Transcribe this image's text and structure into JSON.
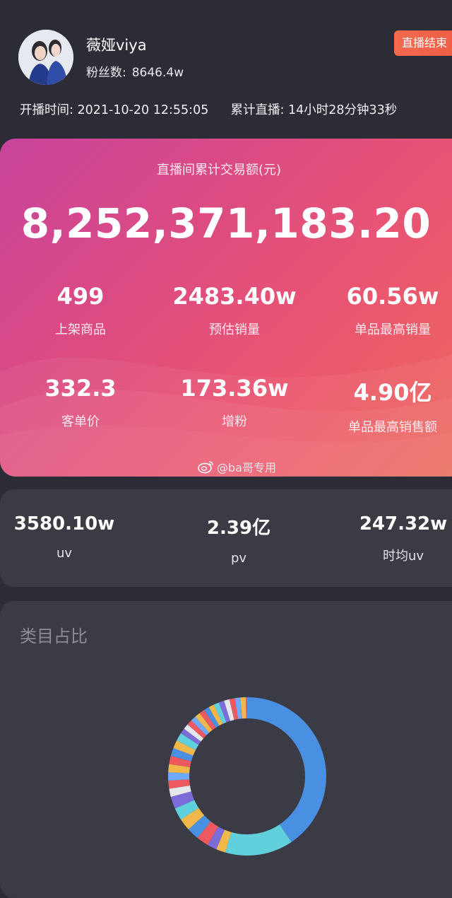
{
  "profile": {
    "name": "薇娅viya",
    "fans_label": "粉丝数:",
    "fans_value": "8646.4w",
    "status_badge": "直播结束",
    "start_time_label": "开播时间:",
    "start_time_value": "2021-10-20 12:55:05",
    "duration_label": "累计直播:",
    "duration_value": "14小时28分钟33秒"
  },
  "gmv": {
    "title": "直播间累计交易额(元)",
    "value": "8,252,371,183.20",
    "stats": [
      {
        "value": "499",
        "label": "上架商品"
      },
      {
        "value": "2483.40w",
        "label": "预估销量"
      },
      {
        "value": "60.56w",
        "label": "单品最高销量"
      },
      {
        "value": "332.3",
        "label": "客单价"
      },
      {
        "value": "173.36w",
        "label": "增粉"
      },
      {
        "value": "4.90亿",
        "label": "单品最高销售额"
      }
    ],
    "watermark": "@ba哥专用"
  },
  "traffic": [
    {
      "value": "3580.10w",
      "label": "uv"
    },
    {
      "value": "2.39亿",
      "label": "pv"
    },
    {
      "value": "247.32w",
      "label": "时均uv"
    }
  ],
  "category": {
    "title": "类目占比"
  },
  "colors": {
    "background": "#2b2c35",
    "card": "#3a3b45",
    "badge": "#f26a4f",
    "donut_main": "#4a90e2",
    "donut_second": "#5fd0dc",
    "donut_red": "#ec5a5f",
    "donut_yellow": "#f0b84a",
    "donut_purple": "#7c6cd8"
  }
}
